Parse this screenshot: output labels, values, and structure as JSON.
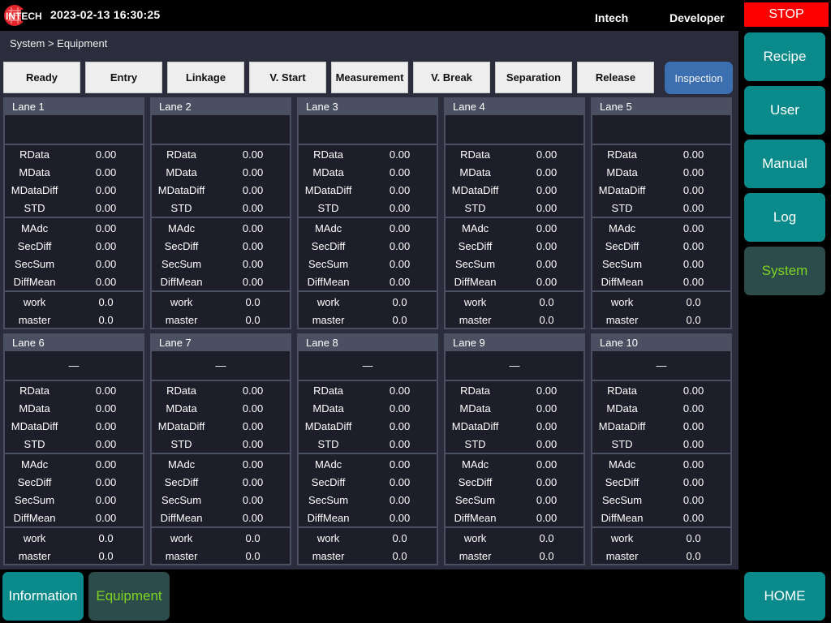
{
  "header": {
    "logo_text": "INTECH",
    "datetime": "2023-02-13 16:30:25",
    "company": "Intech",
    "user_role": "Developer"
  },
  "breadcrumb": "System > Equipment",
  "steps": [
    "Ready",
    "Entry",
    "Linkage",
    "V. Start",
    "Measurement",
    "V. Break",
    "Separation",
    "Release"
  ],
  "inspection_label": "Inspection",
  "lanes": [
    {
      "name": "Lane 1",
      "status": ""
    },
    {
      "name": "Lane 2",
      "status": ""
    },
    {
      "name": "Lane 3",
      "status": ""
    },
    {
      "name": "Lane 4",
      "status": ""
    },
    {
      "name": "Lane 5",
      "status": ""
    },
    {
      "name": "Lane 6",
      "status": "—"
    },
    {
      "name": "Lane 7",
      "status": "—"
    },
    {
      "name": "Lane 8",
      "status": "—"
    },
    {
      "name": "Lane 9",
      "status": "—"
    },
    {
      "name": "Lane 10",
      "status": "—"
    }
  ],
  "metric_groups": [
    [
      {
        "label": "RData",
        "value": "0.00"
      },
      {
        "label": "MData",
        "value": "0.00"
      },
      {
        "label": "MDataDiff",
        "value": "0.00"
      },
      {
        "label": "STD",
        "value": "0.00"
      }
    ],
    [
      {
        "label": "MAdc",
        "value": "0.00"
      },
      {
        "label": "SecDiff",
        "value": "0.00"
      },
      {
        "label": "SecSum",
        "value": "0.00"
      },
      {
        "label": "DiffMean",
        "value": "0.00"
      }
    ],
    [
      {
        "label": "work",
        "value": "0.0"
      },
      {
        "label": "master",
        "value": "0.0"
      }
    ]
  ],
  "sidebar": {
    "stop": "STOP",
    "items": [
      "Recipe",
      "User",
      "Manual",
      "Log",
      "System"
    ],
    "active_index": 4,
    "home": "HOME"
  },
  "bottom_tabs": [
    "Information",
    "Equipment"
  ],
  "bottom_active_index": 1,
  "colors": {
    "accent_teal": "#0a8a8a",
    "active_text": "#7ed321",
    "stop_red": "#ff0000",
    "inspection_blue": "#3b6fb0",
    "logo_red": "#e4262b"
  }
}
